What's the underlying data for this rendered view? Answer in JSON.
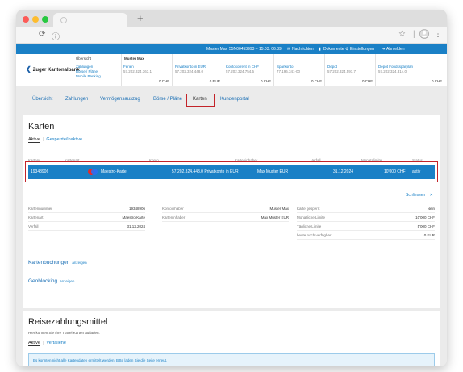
{
  "header": {
    "user": "Muster Max",
    "session_info": "55N00453993 – 15.03. 06:39",
    "nachrichten": "Nachrichten",
    "dokumente": "Dokumente",
    "einstellungen": "Einstellungen",
    "abmelden": "Abmelden"
  },
  "bank": {
    "name": "Zuger Kantonalbank"
  },
  "accounts_header": {
    "col1_title": "Übersicht",
    "col1_links": [
      "Zahlungen",
      "Börse / Pläne",
      "Mobile Banking"
    ],
    "col2_title": "Muster Max"
  },
  "accounts": [
    {
      "name": "Ferien",
      "number": "57.202.324.363.1",
      "amount": "0 CHF"
    },
    {
      "name": "Privatkonto in EUR",
      "number": "57.202.324.448.0",
      "amount": "0 EUR"
    },
    {
      "name": "Kontokorrent in CHF",
      "number": "57.202.324.754.5",
      "amount": "0 CHF"
    },
    {
      "name": "Sparkonto",
      "number": "77.196.341-00",
      "amount": "0 CHF"
    },
    {
      "name": "Depot",
      "number": "57.202.324.591.7",
      "amount": "0 CHF"
    },
    {
      "name": "Depot Fondssparplan",
      "number": "57.202.324.314.0",
      "amount": "0 CHF"
    }
  ],
  "nav": [
    "Übersicht",
    "Zahlungen",
    "Vermögensauszug",
    "Börse / Pläne",
    "Karten",
    "Kundenportal"
  ],
  "cards": {
    "title": "Karten",
    "tab_active": "Aktive",
    "tab_inactive": "Gesperrte/inaktive",
    "columns": [
      "Kartenr.",
      "Kartenart",
      "Konto",
      "Karteninhaber",
      "Verfall",
      "Monatslimite",
      "Status"
    ],
    "row": {
      "number": "19348906",
      "type": "Maestro-Karte",
      "account": "57.202.324.448.0 Privatkonto in EUR",
      "holder": "Max Muster EUR",
      "expiry": "31.12.2024",
      "limit": "10'000 CHF",
      "status": "aktiv"
    },
    "close_label": "Schliessen",
    "close_icon": "✕",
    "details": {
      "left": [
        {
          "k": "Kartennummer",
          "v": "19348906"
        },
        {
          "k": "Kartenart",
          "v": "Maestro-Karte"
        },
        {
          "k": "Verfall",
          "v": "31.12.2024"
        }
      ],
      "middle": [
        {
          "k": "Kontoinhaber",
          "v": "Muster Max"
        },
        {
          "k": "Karteninhaber",
          "v": "Max Muster EUR"
        }
      ],
      "right": [
        {
          "k": "Karte gesperrt",
          "v": "Nein"
        },
        {
          "k": "Monatliche Limite",
          "v": "10'000 CHF"
        },
        {
          "k": "Tägliche Limite",
          "v": "5'000 CHF"
        },
        {
          "k": "heute noch verfügbar",
          "v": "0 EUR"
        }
      ]
    },
    "bookings_label": "Kartenbuchungen",
    "bookings_link": "anzeigen",
    "geoblocking_label": "Geoblocking",
    "geoblocking_link": "anzeigen"
  },
  "travel": {
    "title": "Reisezahlungsmittel",
    "description": "Hier können Sie Ihre Travel Karten aufladen.",
    "tab_active": "Aktive",
    "tab_inactive": "Vertallene",
    "info": "Es konnten nicht alle Kartendaten ermittelt werden. Bitte laden Sie die Seite erneut."
  },
  "colors": {
    "accent": "#1a80c6",
    "highlight": "#c32329"
  }
}
